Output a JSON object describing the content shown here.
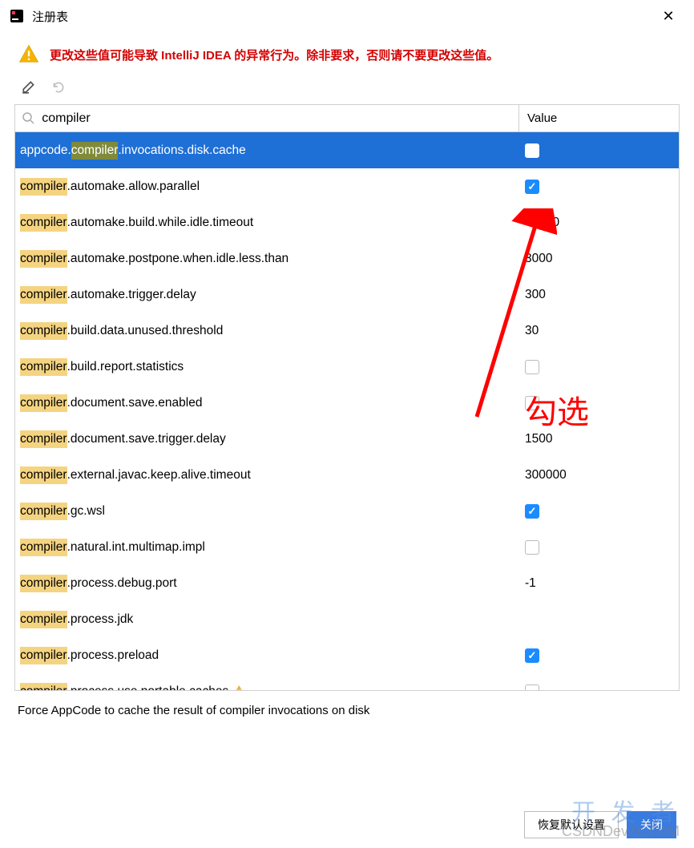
{
  "window": {
    "title": "注册表",
    "close_glyph": "✕"
  },
  "warning": "更改这些值可能导致 IntelliJ IDEA 的异常行为。除非要求，否则请不要更改这些值。",
  "search": {
    "value": "compiler"
  },
  "header": {
    "value_label": "Value"
  },
  "rows": [
    {
      "prefix": "appcode.",
      "match": "compiler",
      "suffix": ".invocations.disk.cache",
      "type": "check",
      "checked": false,
      "selected": true
    },
    {
      "prefix": "",
      "match": "compiler",
      "suffix": ".automake.allow.parallel",
      "type": "check",
      "checked": true
    },
    {
      "prefix": "",
      "match": "compiler",
      "suffix": ".automake.build.while.idle.timeout",
      "type": "text",
      "value": "60000"
    },
    {
      "prefix": "",
      "match": "compiler",
      "suffix": ".automake.postpone.when.idle.less.than",
      "type": "text",
      "value": "3000"
    },
    {
      "prefix": "",
      "match": "compiler",
      "suffix": ".automake.trigger.delay",
      "type": "text",
      "value": "300"
    },
    {
      "prefix": "",
      "match": "compiler",
      "suffix": ".build.data.unused.threshold",
      "type": "text",
      "value": "30"
    },
    {
      "prefix": "",
      "match": "compiler",
      "suffix": ".build.report.statistics",
      "type": "check",
      "checked": false
    },
    {
      "prefix": "",
      "match": "compiler",
      "suffix": ".document.save.enabled",
      "type": "check",
      "checked": false
    },
    {
      "prefix": "",
      "match": "compiler",
      "suffix": ".document.save.trigger.delay",
      "type": "text",
      "value": "1500"
    },
    {
      "prefix": "",
      "match": "compiler",
      "suffix": ".external.javac.keep.alive.timeout",
      "type": "text",
      "value": "300000"
    },
    {
      "prefix": "",
      "match": "compiler",
      "suffix": ".gc.wsl",
      "type": "check",
      "checked": true
    },
    {
      "prefix": "",
      "match": "compiler",
      "suffix": ".natural.int.multimap.impl",
      "type": "check",
      "checked": false
    },
    {
      "prefix": "",
      "match": "compiler",
      "suffix": ".process.debug.port",
      "type": "text",
      "value": "-1"
    },
    {
      "prefix": "",
      "match": "compiler",
      "suffix": ".process.jdk",
      "type": "text",
      "value": ""
    },
    {
      "prefix": "",
      "match": "compiler",
      "suffix": ".process.preload",
      "type": "check",
      "checked": true
    },
    {
      "prefix": "",
      "match": "compiler",
      "suffix": ".process.use.portable.caches",
      "type": "check",
      "checked": false,
      "warn": true
    }
  ],
  "description": "Force AppCode to cache the result of compiler invocations on disk",
  "buttons": {
    "restore": "恢复默认设置",
    "close": "关闭"
  },
  "annotation": "勾选",
  "watermark": {
    "line1": "开 发 者",
    "line2": "CSDNDevZe.CoM"
  }
}
